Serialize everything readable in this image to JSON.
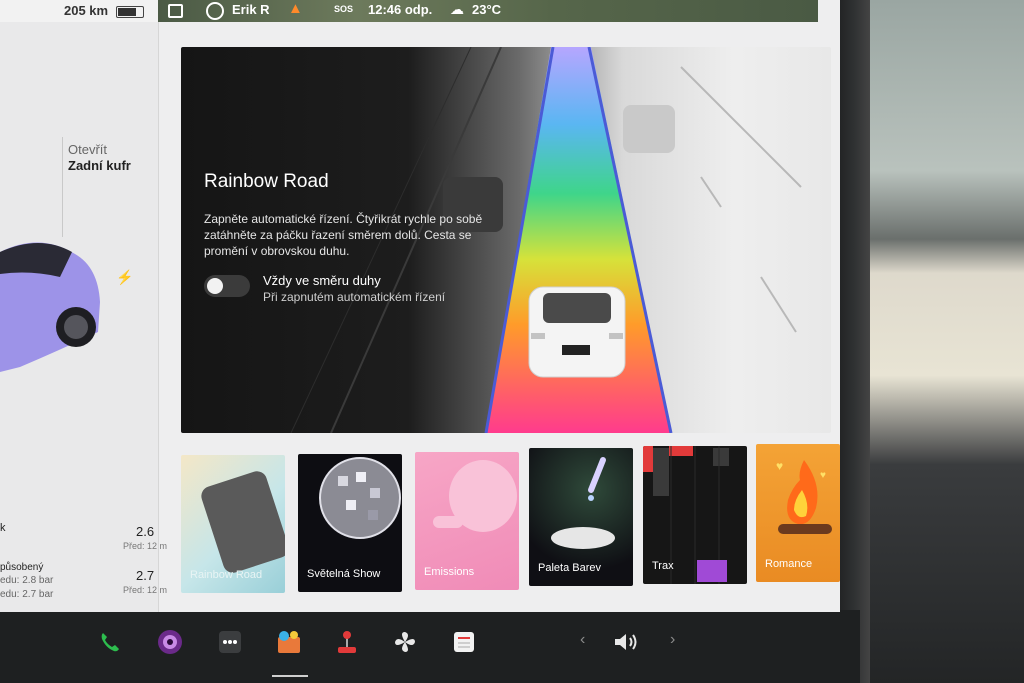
{
  "status": {
    "range": "205 km",
    "user": "Erik R",
    "sos": "SOS",
    "time": "12:46 odp.",
    "temperature": "23°C"
  },
  "left_panel": {
    "trunk_action": "Otevřít",
    "trunk_label": "Zadní kufr",
    "tires": [
      {
        "label": "k",
        "value": "2.6",
        "sub": "Před: 12 m"
      },
      {
        "label": "působený",
        "value": "2.7",
        "sub": "Před: 12 m"
      }
    ],
    "tire_details": [
      "edu: 2.8 bar",
      "edu: 2.7 bar"
    ]
  },
  "hero": {
    "title": "Rainbow Road",
    "description": "Zapněte automatické řízení. Čtyřikrát rychle po sobě zatáhněte za páčku řazení směrem dolů. Cesta se promění v obrovskou duhu.",
    "toggle_label": "Vždy ve směru duhy",
    "toggle_sub": "Při zapnutém automatickém řízení",
    "toggle_on": false
  },
  "tiles": [
    {
      "label": "Rainbow Road",
      "icon": "phone-tilt-icon"
    },
    {
      "label": "Světelná Show",
      "icon": "disco-ball-icon"
    },
    {
      "label": "Emissions",
      "icon": "whoopee-cushion-icon"
    },
    {
      "label": "Paleta Barev",
      "icon": "color-dropper-icon"
    },
    {
      "label": "Trax",
      "icon": "piano-keys-icon"
    },
    {
      "label": "Romance",
      "icon": "fireplace-icon"
    }
  ],
  "dock": {
    "icons": [
      "phone-icon",
      "camera-icon",
      "more-icon",
      "toybox-icon",
      "joystick-icon",
      "fan-icon",
      "notes-icon"
    ],
    "volume": "volume-icon"
  },
  "colors": {
    "screen_bg": "#eeeeef",
    "phone_green": "#2dbd4e",
    "rainbow": [
      "#ff3b8d",
      "#ff9b2a",
      "#d6e23a",
      "#3fd58a",
      "#3f9cf0",
      "#7a5df0"
    ]
  }
}
